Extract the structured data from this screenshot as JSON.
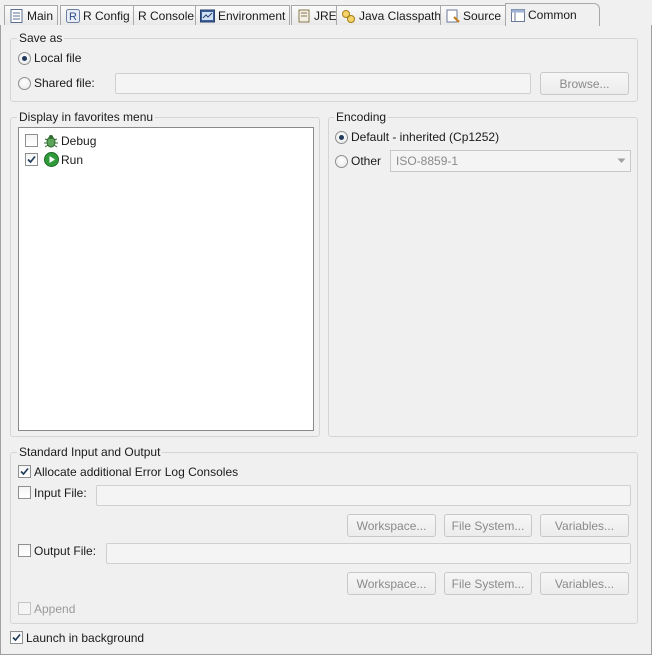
{
  "tabs": [
    {
      "label": "Main",
      "icon": "document-icon"
    },
    {
      "label": "R Config",
      "icon": "r-icon"
    },
    {
      "label": "R Console",
      "icon": "console-icon"
    },
    {
      "label": "Environment",
      "icon": "environment-icon"
    },
    {
      "label": "JRE",
      "icon": "jre-icon"
    },
    {
      "label": "Java Classpath",
      "icon": "classpath-icon"
    },
    {
      "label": "Source",
      "icon": "source-icon"
    },
    {
      "label": "Common",
      "icon": "common-icon",
      "active": true
    }
  ],
  "save_as": {
    "title": "Save as",
    "local_file": "Local file",
    "shared_file": "Shared file:",
    "shared_value": "",
    "browse": "Browse...",
    "selected": "local_file"
  },
  "favorites": {
    "title": "Display in favorites menu",
    "items": [
      {
        "label": "Debug",
        "checked": false,
        "icon": "debug-bug-icon"
      },
      {
        "label": "Run",
        "checked": true,
        "icon": "run-icon"
      }
    ]
  },
  "encoding": {
    "title": "Encoding",
    "default_label": "Default - inherited (Cp1252)",
    "other_label": "Other",
    "other_value": "ISO-8859-1",
    "selected": "default"
  },
  "stdio": {
    "title": "Standard Input and Output",
    "allocate_label": "Allocate additional Error Log Consoles",
    "allocate_checked": true,
    "input_file_label": "Input File:",
    "input_file_value": "",
    "output_file_label": "Output File:",
    "output_file_value": "",
    "workspace": "Workspace...",
    "file_system": "File System...",
    "variables": "Variables...",
    "append_label": "Append"
  },
  "launch_background": {
    "label": "Launch in background",
    "checked": true
  },
  "colors": {
    "run_green": "#2e9a3a",
    "debug_green": "#3b8a3b"
  }
}
